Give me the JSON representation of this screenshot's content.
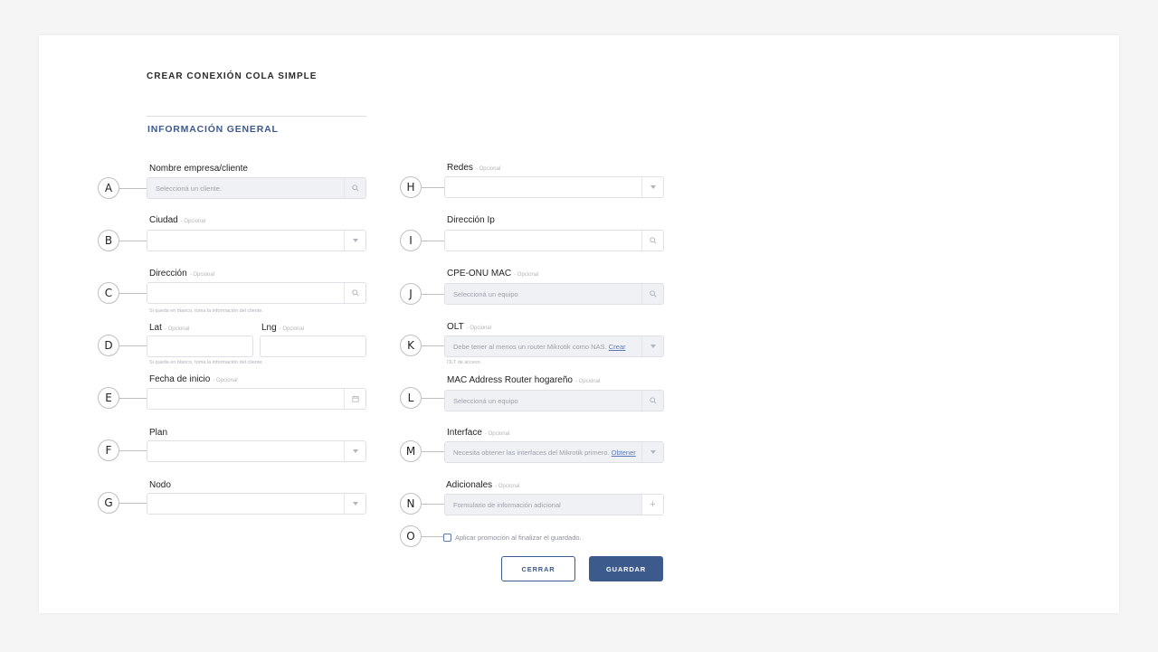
{
  "page": {
    "title": "CREAR CONEXIÓN COLA SIMPLE",
    "section_title": "INFORMACIÓN GENERAL"
  },
  "optional_tag": "- Opcional",
  "markers": [
    "A",
    "B",
    "C",
    "D",
    "E",
    "F",
    "G",
    "H",
    "I",
    "J",
    "K",
    "L",
    "M",
    "N",
    "O"
  ],
  "left": {
    "client": {
      "label": "Nombre empresa/cliente",
      "placeholder": "Seleccioná un cliente.",
      "icon": "search-icon"
    },
    "city": {
      "label": "Ciudad",
      "icon": "chevron-down-icon"
    },
    "address": {
      "label": "Dirección",
      "icon": "search-icon",
      "help": "Si queda en blanco, toma la información del cliente."
    },
    "lat": {
      "label": "Lat"
    },
    "lng": {
      "label": "Lng",
      "help": "Si queda en blanco, toma la información del cliente."
    },
    "start_date": {
      "label": "Fecha de inicio",
      "icon": "calendar-icon"
    },
    "plan": {
      "label": "Plan",
      "icon": "chevron-down-icon"
    },
    "node": {
      "label": "Nodo",
      "icon": "chevron-down-icon"
    }
  },
  "right": {
    "networks": {
      "label": "Redes",
      "icon": "chevron-down-icon"
    },
    "ip": {
      "label": "Dirección Ip",
      "icon": "search-icon"
    },
    "cpe": {
      "label": "CPE-ONU MAC",
      "placeholder": "Seleccioná un equipo",
      "icon": "search-icon"
    },
    "olt": {
      "label": "OLT",
      "placeholder": "Debe tener al menos un router Mikrotik como NAS.",
      "link": "Crear",
      "help": "OLT de acceso",
      "icon": "chevron-down-icon"
    },
    "mac_router": {
      "label": "MAC Address Router hogareño",
      "placeholder": "Seleccioná un equipo",
      "icon": "search-icon"
    },
    "interface": {
      "label": "Interface",
      "placeholder": "Necesita obtener las interfaces del Mikrotik primero.",
      "link": "Obtener",
      "icon": "chevron-down-icon"
    },
    "additional": {
      "label": "Adicionales",
      "placeholder": "Formulario de información adicional",
      "icon": "plus-icon",
      "icon_glyph": "+"
    }
  },
  "promo_checkbox": {
    "label": "Aplicar promoción al finalizar el guardado.",
    "checked": false
  },
  "buttons": {
    "cancel": "CERRAR",
    "save": "GUARDAR"
  },
  "colors": {
    "accent": "#3c5a8c",
    "field_border": "#dde1e6",
    "disabled_bg": "#f0f1f5"
  }
}
